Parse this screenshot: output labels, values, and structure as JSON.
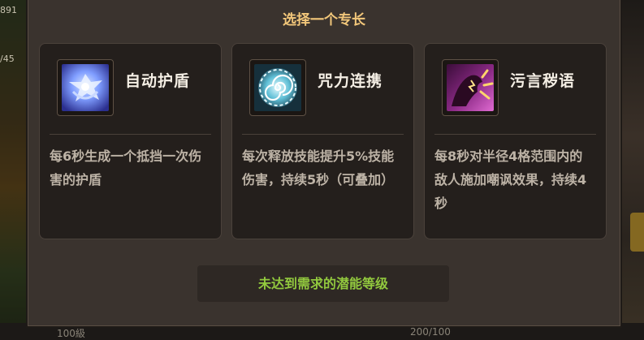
{
  "background": {
    "left_value_top": "891",
    "left_value_mid": "/45",
    "bottom_left": "100級",
    "bottom_right": "200/100"
  },
  "dialog": {
    "title": "选择一个专长",
    "notice": "未达到需求的潜能等级"
  },
  "perks": [
    {
      "name": "自动护盾",
      "icon": "shield-bird-icon",
      "desc": "每6秒生成一个抵挡一次伤害的护盾"
    },
    {
      "name": "咒力连携",
      "icon": "spiral-rune-icon",
      "desc": "每次释放技能提升5%技能伤害，持续5秒（可叠加）"
    },
    {
      "name": "污言秽语",
      "icon": "taunt-demon-icon",
      "desc": "每8秒对半径4格范围内的敌人施加嘲讽效果，持续4秒"
    }
  ],
  "colors": {
    "title": "#f2c77a",
    "notice": "#92c93e",
    "card_bg": "#241f1c",
    "panel_bg": "#3a332e"
  }
}
